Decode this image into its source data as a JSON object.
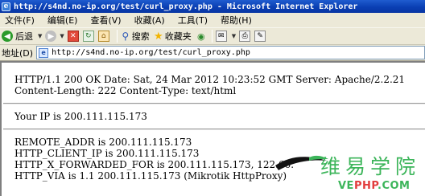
{
  "window": {
    "title": "http://s4nd.no-ip.org/test/curl_proxy.php - Microsoft Internet Explorer"
  },
  "menu": [
    "文件(F)",
    "编辑(E)",
    "查看(V)",
    "收藏(A)",
    "工具(T)",
    "帮助(H)"
  ],
  "toolbar": {
    "back_label": "后退",
    "search_label": "搜索",
    "favorites_label": "收藏夹"
  },
  "address": {
    "label": "地址(D)",
    "url": "http://s4nd.no-ip.org/test/curl_proxy.php"
  },
  "page": {
    "header_line1": "HTTP/1.1 200 OK Date: Sat, 24 Mar 2012 10:23:52 GMT Server: Apache/2.2.21",
    "header_line2": "Content-Length: 222 Content-Type: text/html",
    "ip_line": "Your IP is 200.111.115.173",
    "remote_addr": "REMOTE_ADDR is 200.111.115.173",
    "client_ip": "HTTP_CLIENT_IP is 200.111.115.173",
    "forwarded_for": "HTTP_X_FORWARDED_FOR is 200.111.115.173, 122.66.",
    "via": "HTTP_VIA is 1.1 200.111.115.173 (Mikrotik HttpProxy)"
  },
  "watermark": {
    "cn_text": "维易学院",
    "url_prefix": "VE",
    "url_accent": "PHP",
    "url_suffix": ".COM"
  },
  "colors": {
    "titlebar": "#0a3fb4",
    "chrome": "#ece9d8",
    "watermark_green": "#3cb55a",
    "watermark_red": "#e23c3c"
  }
}
